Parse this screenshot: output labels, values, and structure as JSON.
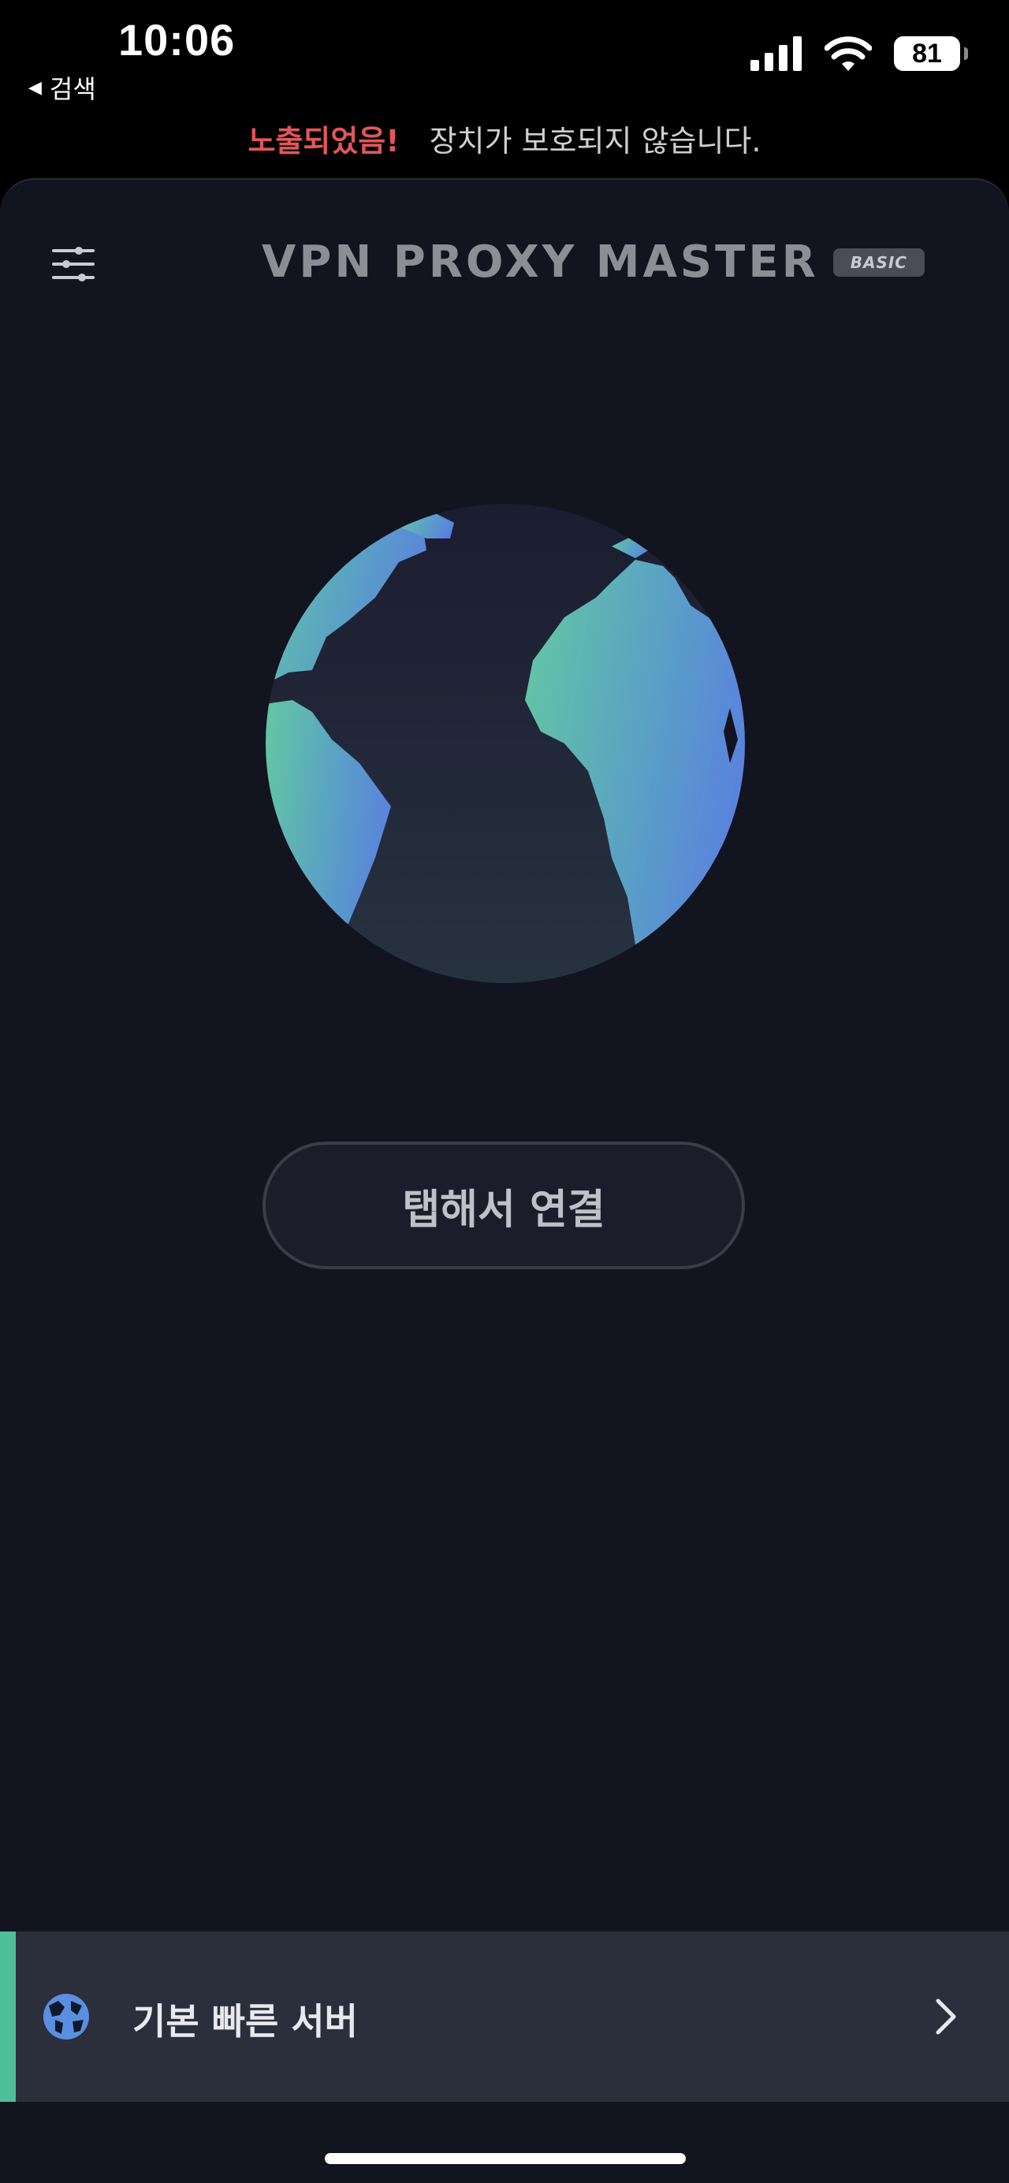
{
  "status_bar": {
    "time": "10:06",
    "back_app": "검색",
    "battery": "81"
  },
  "warning": {
    "exposed": "노출되었음!",
    "message": "장치가 보호되지 않습니다."
  },
  "header": {
    "logo": "VPN PROXY MASTER",
    "badge": "BASIC"
  },
  "main": {
    "connect_label": "탭해서 연결"
  },
  "server": {
    "label": "기본 빠른 서버"
  },
  "colors": {
    "background": "#12141f",
    "warning": "#e0575a",
    "accent": "#4fbf9a",
    "globe_gradient_start": "#5fbfa6",
    "globe_gradient_end": "#5a7fe0"
  },
  "icons": {
    "menu": "sliders-icon",
    "globe": "globe-icon",
    "server": "globe-small-icon",
    "chevron": "chevron-right-icon"
  }
}
